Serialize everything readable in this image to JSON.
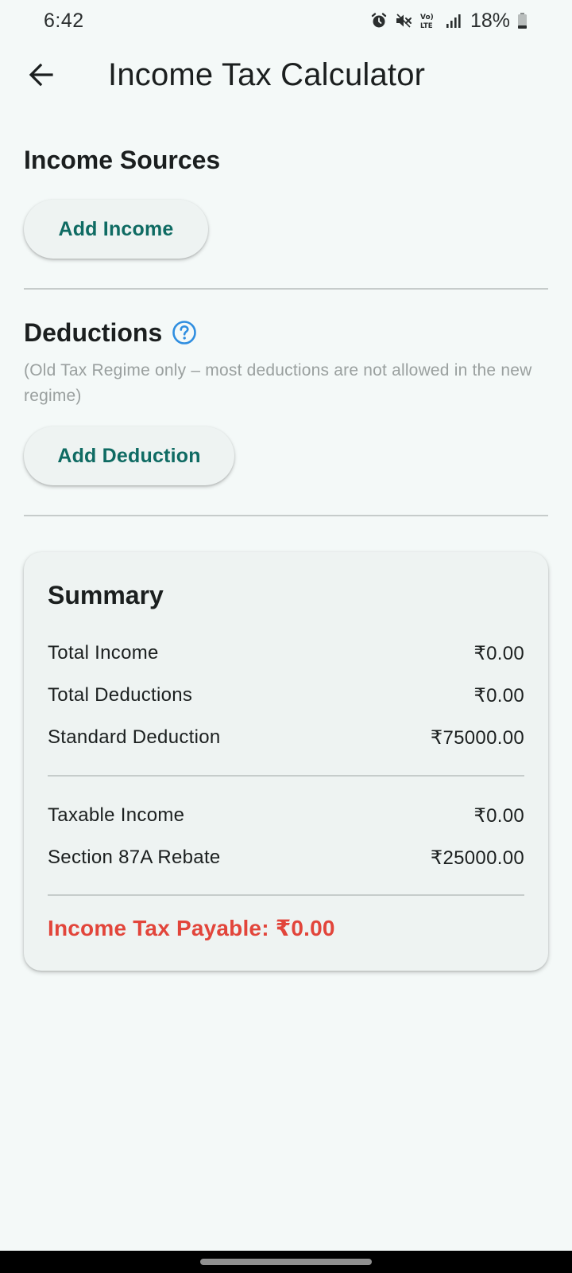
{
  "status_bar": {
    "time": "6:42",
    "battery_percent": "18%",
    "icons": [
      "alarm-icon",
      "mute-icon",
      "volte-icon",
      "signal-icon",
      "battery-icon"
    ]
  },
  "app_bar": {
    "back_icon": "arrow-back-icon",
    "title": "Income Tax Calculator"
  },
  "income_sources": {
    "heading": "Income Sources",
    "add_button": "Add Income"
  },
  "deductions": {
    "heading": "Deductions",
    "help_icon": "help-circle-icon",
    "note": "(Old Tax Regime only – most deductions are not allowed in the new regime)",
    "add_button": "Add Deduction"
  },
  "summary": {
    "title": "Summary",
    "rows": [
      {
        "label": "Total Income",
        "value": "₹0.00"
      },
      {
        "label": "Total Deductions",
        "value": "₹0.00"
      },
      {
        "label": "Standard Deduction",
        "value": "₹75000.00"
      },
      {
        "label": "Taxable Income",
        "value": "₹0.00"
      },
      {
        "label": "Section 87A Rebate",
        "value": "₹25000.00"
      }
    ],
    "tax_payable": "Income Tax Payable: ₹0.00"
  },
  "colors": {
    "background": "#f4f9f8",
    "accent_teal": "#0f6b63",
    "help_blue": "#2f8ee0",
    "tax_red": "#e2453b"
  }
}
